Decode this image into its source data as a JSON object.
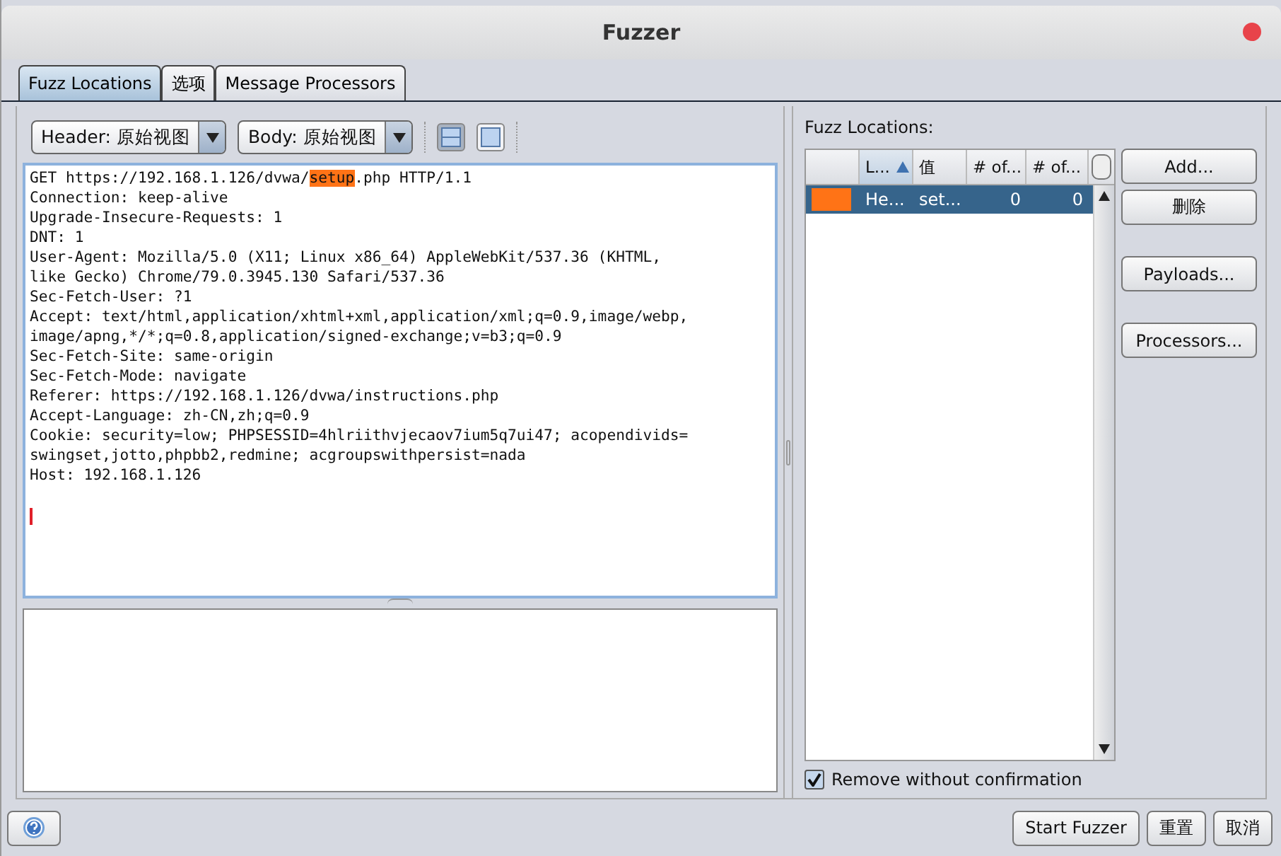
{
  "window": {
    "title": "Fuzzer"
  },
  "tabs": [
    {
      "label": "Fuzz Locations",
      "selected": true
    },
    {
      "label": "选项",
      "selected": false
    },
    {
      "label": "Message Processors",
      "selected": false
    }
  ],
  "view_selectors": [
    {
      "label": "Header: 原始视图"
    },
    {
      "label": "Body: 原始视图"
    }
  ],
  "layout_toggles": [
    {
      "selected": true
    },
    {
      "selected": false
    }
  ],
  "request": {
    "lines": [
      [
        {
          "text": "GET https://192.168.1.126/dvwa/",
          "highlighted": false
        },
        {
          "text": "setup",
          "highlighted": true
        },
        {
          "text": ".php HTTP/1.1",
          "highlighted": false
        }
      ],
      [
        {
          "text": "Connection: keep-alive",
          "highlighted": false
        }
      ],
      [
        {
          "text": "Upgrade-Insecure-Requests: 1",
          "highlighted": false
        }
      ],
      [
        {
          "text": "DNT: 1",
          "highlighted": false
        }
      ],
      [
        {
          "text": "User-Agent: Mozilla/5.0 (X11; Linux x86_64) AppleWebKit/537.36 (KHTML,",
          "highlighted": false
        }
      ],
      [
        {
          "text": "like Gecko) Chrome/79.0.3945.130 Safari/537.36",
          "highlighted": false
        }
      ],
      [
        {
          "text": "Sec-Fetch-User: ?1",
          "highlighted": false
        }
      ],
      [
        {
          "text": "Accept: text/html,application/xhtml+xml,application/xml;q=0.9,image/webp,",
          "highlighted": false
        }
      ],
      [
        {
          "text": "image/apng,*/*;q=0.8,application/signed-exchange;v=b3;q=0.9",
          "highlighted": false
        }
      ],
      [
        {
          "text": "Sec-Fetch-Site: same-origin",
          "highlighted": false
        }
      ],
      [
        {
          "text": "Sec-Fetch-Mode: navigate",
          "highlighted": false
        }
      ],
      [
        {
          "text": "Referer: https://192.168.1.126/dvwa/instructions.php",
          "highlighted": false
        }
      ],
      [
        {
          "text": "Accept-Language: zh-CN,zh;q=0.9",
          "highlighted": false
        }
      ],
      [
        {
          "text": "Cookie: security=low; PHPSESSID=4hlriithvjecaov7ium5q7ui47; acopendivids=",
          "highlighted": false
        }
      ],
      [
        {
          "text": "swingset,jotto,phpbb2,redmine; acgroupswithpersist=nada",
          "highlighted": false
        }
      ],
      [
        {
          "text": "Host: 192.168.1.126",
          "highlighted": false
        }
      ]
    ]
  },
  "fuzz_locations": {
    "label": "Fuzz Locations:",
    "columns": [
      {
        "label": "L...",
        "sorted": true
      },
      {
        "label": "值",
        "sorted": false
      },
      {
        "label": "# of...",
        "sorted": false
      },
      {
        "label": "# of...",
        "sorted": false
      }
    ],
    "rows": [
      {
        "color": "#ff7316",
        "cells": [
          "He...",
          "set...",
          "0",
          "0"
        ],
        "selected": true
      }
    ],
    "buttons": [
      "Add...",
      "删除",
      "Payloads...",
      "Processors..."
    ],
    "remove_without_confirmation": {
      "label": "Remove without confirmation",
      "checked": true
    }
  },
  "footer_buttons": [
    "Start Fuzzer",
    "重置",
    "取消"
  ]
}
